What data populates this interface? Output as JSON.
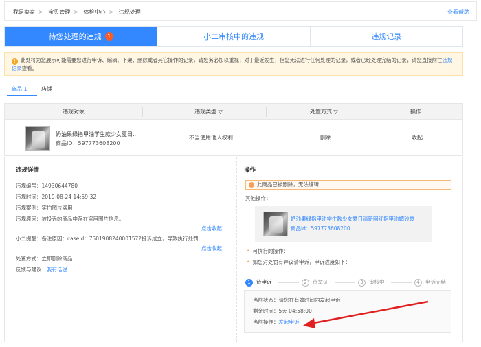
{
  "breadcrumb": [
    "我是卖家",
    "宝贝管理",
    "体检中心",
    "违规处理"
  ],
  "help_link": "查看帮助",
  "tabs": [
    {
      "label": "待您处理的违规",
      "badge": "1"
    },
    {
      "label": "小二审核中的违规"
    },
    {
      "label": "违规记录"
    }
  ],
  "notice": {
    "text": "此处将为您展示可能需要您进行申诉、编辑、下架、删除或者其它操作的记录，请您务必加以重视；对于最近发生，但您无法进行任何处理的记录，或者已经处理完结的记录，请您直接前往",
    "link": "违规记录",
    "tail": "查看。"
  },
  "sub_tabs": [
    "商品 1",
    "店铺"
  ],
  "table": {
    "headers": [
      "违规对象",
      "违规类型 ▽",
      "处置方式 ▽",
      "操作"
    ],
    "row": {
      "product_name": "奶油果绿指甲油学生款少女夏日...",
      "product_id": "商品ID：597773608200",
      "violation_type": "不当使用他人权利",
      "disposal": "删除",
      "action": "收起"
    }
  },
  "details": {
    "title": "违规详情",
    "fields": [
      "违规编号：14930644780",
      "违规时间：2019-08-24 14:59:32",
      "违规案例：实拍图片盗用",
      "违规原因：被投诉的商品中存在盗用图片信息。",
      "小二提醒：备注原因：caseId：7501908240001572投诉成立，导致执行处罚",
      "处置方式：立即删除商品",
      "反馈与建议："
    ],
    "feedback_link": "我有话说",
    "collapse_1": "点击收起",
    "collapse_2": "点击收起"
  },
  "operation": {
    "title": "操作",
    "alert": "此商品已被删除，无法编辑",
    "other_ops": "其他操作：",
    "mini_product_name": "奶油果绿指甲油学生款少女夏日清新网红指甲油媚砂裹",
    "mini_product_id": "商品id：597773608200",
    "bullet_1": "可执行的操作：",
    "bullet_2": "如您对处罚有异议请申诉，申诉进度如下：",
    "steps": [
      {
        "num": "1",
        "label": "待申诉"
      },
      {
        "num": "2",
        "label": "待举证"
      },
      {
        "num": "3",
        "label": "审核中"
      },
      {
        "num": "4",
        "label": "申诉完结"
      }
    ],
    "status_line": "当前状态：请您在有效时间内发起申诉",
    "remaining_line": "剩余时间：5天 04:58:00",
    "current_op_label": "当前操作：",
    "current_op_link": "发起申诉"
  },
  "colors": {
    "accent": "#3388ff",
    "badge": "#ff5a1f",
    "arrow": "#e02020"
  }
}
